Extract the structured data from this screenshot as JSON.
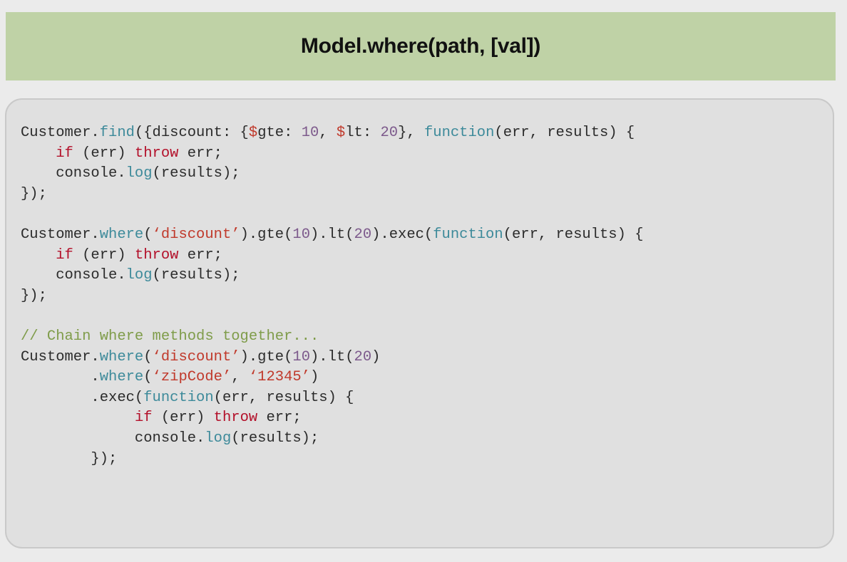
{
  "slide": {
    "title": "Model.where(path, [val])"
  },
  "colors": {
    "title_bar": "#bfd2a6",
    "panel_bg": "#e0e0e0",
    "plain": "#2b2b2b",
    "method": "#3d8a9a",
    "keyword": "#b3102a",
    "string": "#c0392b",
    "number": "#7d5a8c",
    "comment": "#7f9c4a"
  },
  "code": {
    "lines": [
      [
        {
          "t": "Customer.",
          "c": "plain"
        },
        {
          "t": "find",
          "c": "method"
        },
        {
          "t": "({discount: {",
          "c": "plain"
        },
        {
          "t": "$",
          "c": "string"
        },
        {
          "t": "gte: ",
          "c": "plain"
        },
        {
          "t": "10",
          "c": "number"
        },
        {
          "t": ", ",
          "c": "plain"
        },
        {
          "t": "$",
          "c": "string"
        },
        {
          "t": "lt: ",
          "c": "plain"
        },
        {
          "t": "20",
          "c": "number"
        },
        {
          "t": "}, ",
          "c": "plain"
        },
        {
          "t": "function",
          "c": "method"
        },
        {
          "t": "(err, results) {",
          "c": "plain"
        }
      ],
      [
        {
          "t": "    ",
          "c": "plain"
        },
        {
          "t": "if",
          "c": "keyword"
        },
        {
          "t": " (err) ",
          "c": "plain"
        },
        {
          "t": "throw",
          "c": "keyword"
        },
        {
          "t": " err;",
          "c": "plain"
        }
      ],
      [
        {
          "t": "    console.",
          "c": "plain"
        },
        {
          "t": "log",
          "c": "method"
        },
        {
          "t": "(results);",
          "c": "plain"
        }
      ],
      [
        {
          "t": "});",
          "c": "plain"
        }
      ],
      [
        {
          "t": "",
          "c": "plain"
        }
      ],
      [
        {
          "t": "Customer.",
          "c": "plain"
        },
        {
          "t": "where",
          "c": "method"
        },
        {
          "t": "(",
          "c": "plain"
        },
        {
          "t": "‘discount’",
          "c": "string"
        },
        {
          "t": ").gte(",
          "c": "plain"
        },
        {
          "t": "10",
          "c": "number"
        },
        {
          "t": ").lt(",
          "c": "plain"
        },
        {
          "t": "20",
          "c": "number"
        },
        {
          "t": ").exec(",
          "c": "plain"
        },
        {
          "t": "function",
          "c": "method"
        },
        {
          "t": "(err, results) {",
          "c": "plain"
        }
      ],
      [
        {
          "t": "    ",
          "c": "plain"
        },
        {
          "t": "if",
          "c": "keyword"
        },
        {
          "t": " (err) ",
          "c": "plain"
        },
        {
          "t": "throw",
          "c": "keyword"
        },
        {
          "t": " err;",
          "c": "plain"
        }
      ],
      [
        {
          "t": "    console.",
          "c": "plain"
        },
        {
          "t": "log",
          "c": "method"
        },
        {
          "t": "(results);",
          "c": "plain"
        }
      ],
      [
        {
          "t": "});",
          "c": "plain"
        }
      ],
      [
        {
          "t": "",
          "c": "plain"
        }
      ],
      [
        {
          "t": "// Chain where methods together...",
          "c": "comment"
        }
      ],
      [
        {
          "t": "Customer.",
          "c": "plain"
        },
        {
          "t": "where",
          "c": "method"
        },
        {
          "t": "(",
          "c": "plain"
        },
        {
          "t": "‘discount’",
          "c": "string"
        },
        {
          "t": ").gte(",
          "c": "plain"
        },
        {
          "t": "10",
          "c": "number"
        },
        {
          "t": ").lt(",
          "c": "plain"
        },
        {
          "t": "20",
          "c": "number"
        },
        {
          "t": ")",
          "c": "plain"
        }
      ],
      [
        {
          "t": "        .",
          "c": "plain"
        },
        {
          "t": "where",
          "c": "method"
        },
        {
          "t": "(",
          "c": "plain"
        },
        {
          "t": "‘zipCode’",
          "c": "string"
        },
        {
          "t": ", ",
          "c": "plain"
        },
        {
          "t": "‘12345’",
          "c": "string"
        },
        {
          "t": ")",
          "c": "plain"
        }
      ],
      [
        {
          "t": "        .exec(",
          "c": "plain"
        },
        {
          "t": "function",
          "c": "method"
        },
        {
          "t": "(err, results) {",
          "c": "plain"
        }
      ],
      [
        {
          "t": "             ",
          "c": "plain"
        },
        {
          "t": "if",
          "c": "keyword"
        },
        {
          "t": " (err) ",
          "c": "plain"
        },
        {
          "t": "throw",
          "c": "keyword"
        },
        {
          "t": " err;",
          "c": "plain"
        }
      ],
      [
        {
          "t": "             console.",
          "c": "plain"
        },
        {
          "t": "log",
          "c": "method"
        },
        {
          "t": "(results);",
          "c": "plain"
        }
      ],
      [
        {
          "t": "        });",
          "c": "plain"
        }
      ]
    ]
  }
}
